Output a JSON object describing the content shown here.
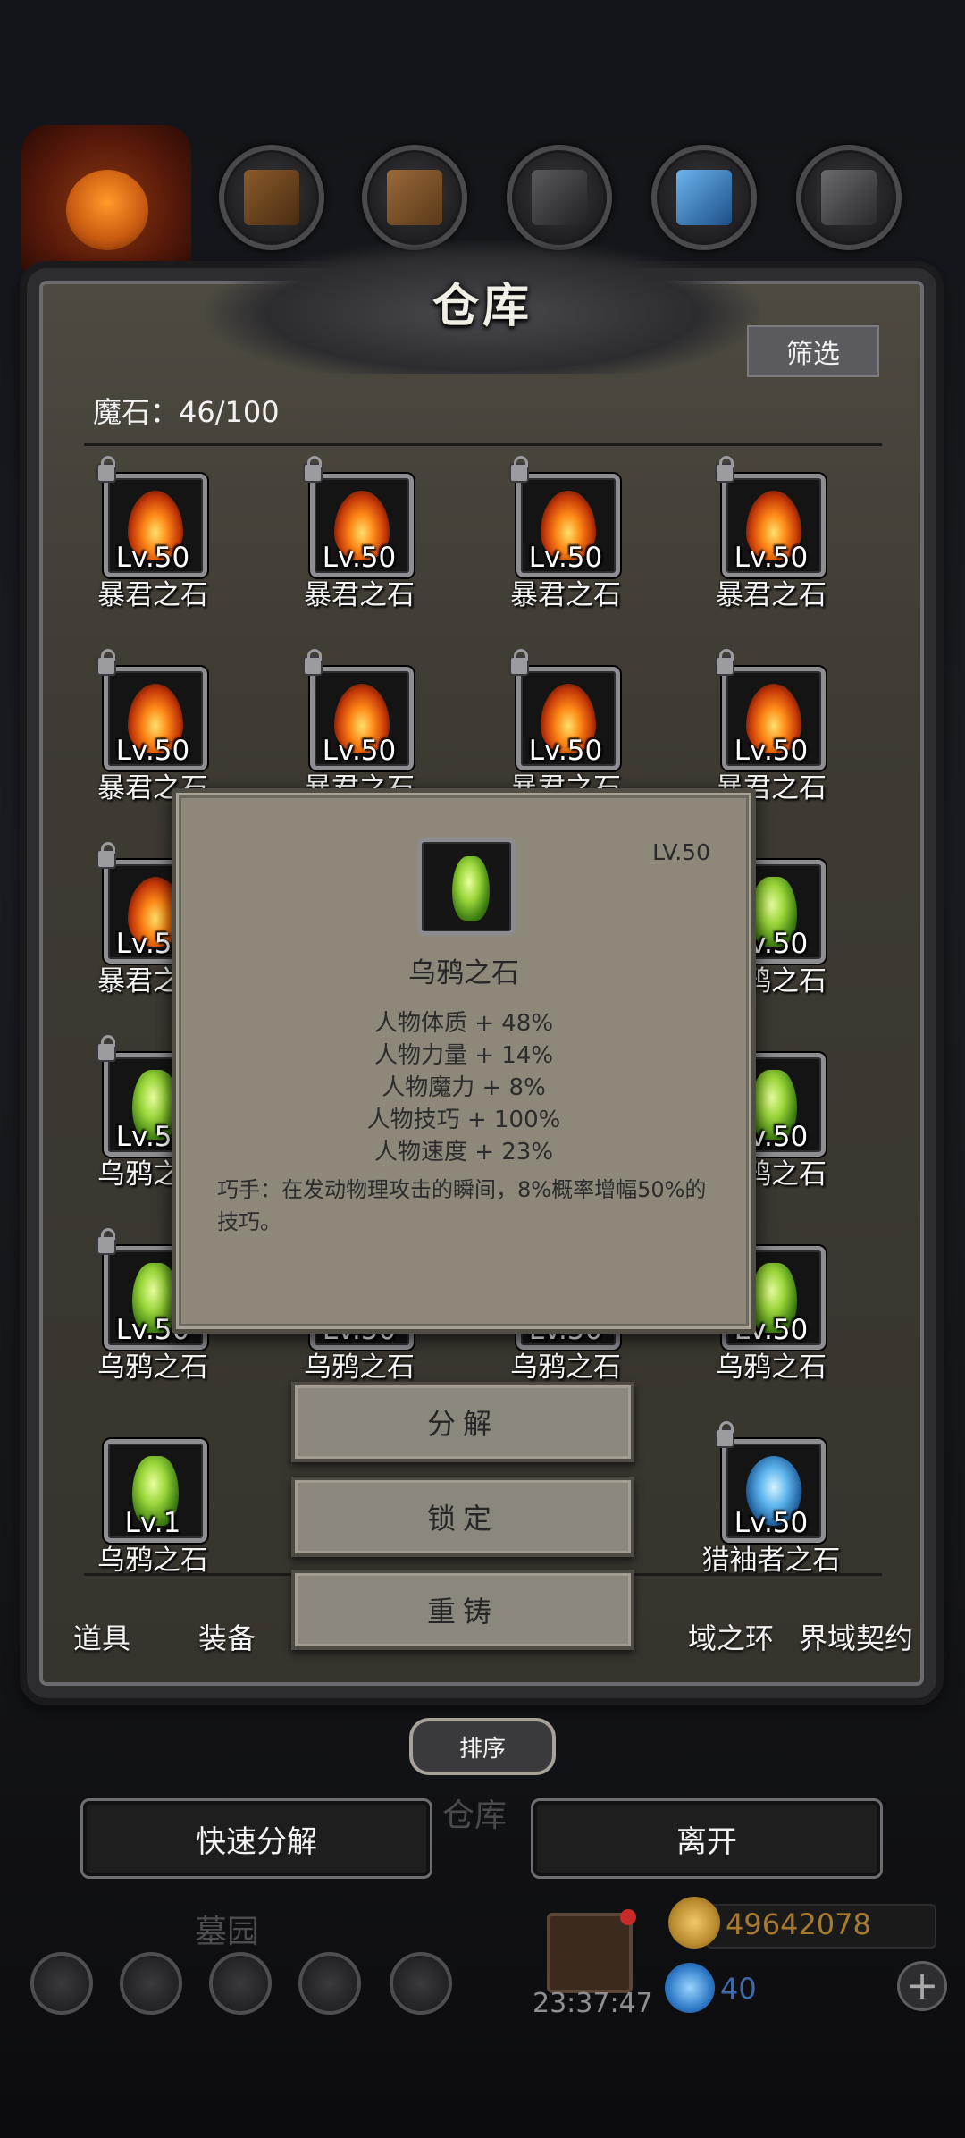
{
  "colors": {
    "panel_bg": "#3f3b33",
    "popup_bg": "#8e887b",
    "gold_text": "#a77a2e",
    "gem_text": "#3f6aa8"
  },
  "panel": {
    "title": "仓库",
    "filter_label": "筛选",
    "stone_count": "魔石：46/100"
  },
  "grid": {
    "rows": [
      [
        {
          "level": "Lv.50",
          "name": "暴君之石",
          "type": "fire",
          "locked": true
        },
        {
          "level": "Lv.50",
          "name": "暴君之石",
          "type": "fire",
          "locked": true
        },
        {
          "level": "Lv.50",
          "name": "暴君之石",
          "type": "fire",
          "locked": true
        },
        {
          "level": "Lv.50",
          "name": "暴君之石",
          "type": "fire",
          "locked": true
        }
      ],
      [
        {
          "level": "Lv.50",
          "name": "暴君之石",
          "type": "fire",
          "locked": true
        },
        {
          "level": "Lv.50",
          "name": "暴君之石",
          "type": "fire",
          "locked": true
        },
        {
          "level": "Lv.50",
          "name": "暴君之石",
          "type": "fire",
          "locked": true
        },
        {
          "level": "Lv.50",
          "name": "暴君之石",
          "type": "fire",
          "locked": true
        }
      ],
      [
        {
          "level": "Lv.50",
          "name": "暴君之石",
          "type": "fire",
          "locked": true
        },
        null,
        null,
        {
          "level": "Lv.50",
          "name": "乌鸦之石",
          "type": "green",
          "locked": false
        }
      ],
      [
        {
          "level": "Lv.50",
          "name": "乌鸦之石",
          "type": "green",
          "locked": true
        },
        null,
        null,
        {
          "level": "Lv.50",
          "name": "乌鸦之石",
          "type": "green",
          "locked": false
        }
      ],
      [
        {
          "level": "Lv.50",
          "name": "乌鸦之石",
          "type": "green",
          "locked": true
        },
        {
          "level": "Lv.50",
          "name": "乌鸦之石",
          "type": "green",
          "locked": false
        },
        {
          "level": "Lv.50",
          "name": "乌鸦之石",
          "type": "green",
          "locked": false
        },
        {
          "level": "Lv.50",
          "name": "乌鸦之石",
          "type": "green",
          "locked": false
        }
      ],
      [
        {
          "level": "Lv.1",
          "name": "乌鸦之石",
          "type": "green",
          "locked": false
        },
        null,
        null,
        {
          "level": "Lv.50",
          "name": "猎袖者之石",
          "type": "blue",
          "locked": true
        }
      ]
    ]
  },
  "tabs": [
    "道具",
    "装备",
    "域之环",
    "界域契约"
  ],
  "sort_label": "排序",
  "warehouse_ghost": "仓库",
  "quick_decompose_label": "快速分解",
  "leave_label": "离开",
  "hud": {
    "graveyard": "墓园",
    "clock": "23:37:47",
    "gold": "49642078",
    "gems": "40",
    "plus": "+"
  },
  "popup": {
    "level": "LV.50",
    "name": "乌鸦之石",
    "stats": [
      "人物体质 + 48%",
      "人物力量 + 14%",
      "人物魔力 + 8%",
      "人物技巧 + 100%",
      "人物速度 + 23%"
    ],
    "description": "巧手：在发动物理攻击的瞬间，8%概率增幅50%的技巧。"
  },
  "actions": {
    "decompose": "分解",
    "lock": "锁定",
    "recast": "重铸"
  }
}
